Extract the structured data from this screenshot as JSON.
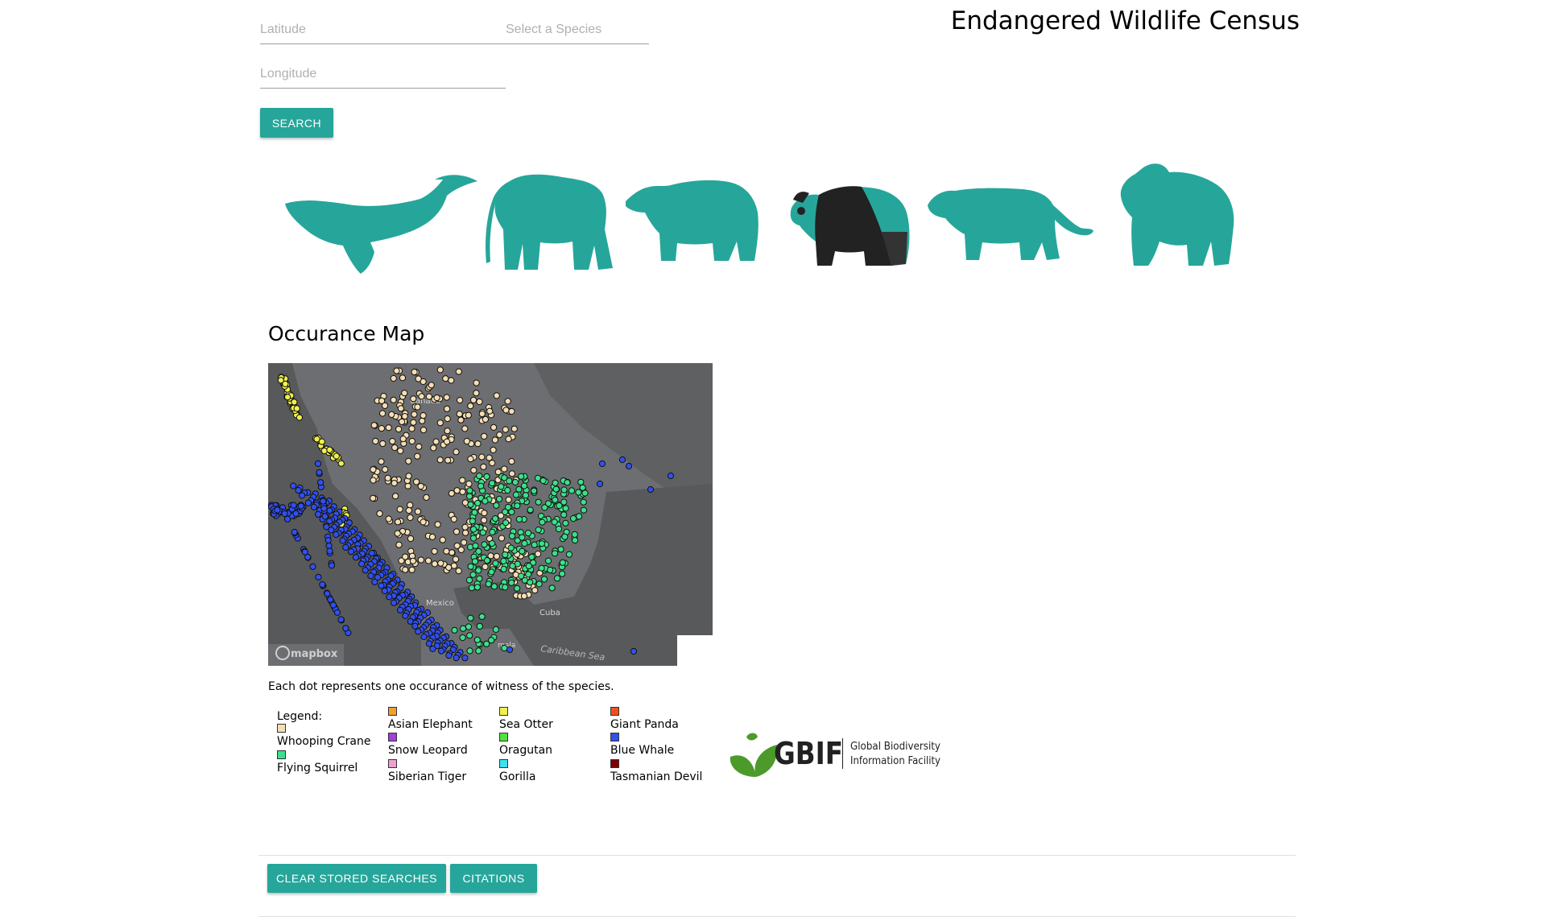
{
  "header": {
    "title": "Endangered Wildlife Census"
  },
  "search": {
    "latitude_placeholder": "Latitude",
    "longitude_placeholder": "Longitude",
    "species_placeholder": "Select a Species",
    "button_label": "SEARCH"
  },
  "animals": [
    "whale-icon",
    "elephant-icon",
    "bear-icon",
    "panda-icon",
    "tiger-icon",
    "gorilla-icon"
  ],
  "map": {
    "title": "Occurance Map",
    "labels": {
      "canada": "Canada",
      "mexico": "Mexico",
      "cuba": "Cuba",
      "guatemala": "mala",
      "caribbean": "Caribbean Sea"
    },
    "attribution": "mapbox",
    "note": "Each dot represents one occurance of witness of the species."
  },
  "legend": {
    "title": "Legend:",
    "items": [
      {
        "label": "Whooping Crane",
        "color": "#f5deb3"
      },
      {
        "label": "Flying Squirrel",
        "color": "#3ce08a"
      },
      {
        "label": "Asian Elephant",
        "color": "#f0a030"
      },
      {
        "label": "Snow Leopard",
        "color": "#a040e0"
      },
      {
        "label": "Siberian Tiger",
        "color": "#f0a0d0"
      },
      {
        "label": "Sea Otter",
        "color": "#f0f050"
      },
      {
        "label": "Oragutan",
        "color": "#50e040"
      },
      {
        "label": "Gorilla",
        "color": "#40e0f0"
      },
      {
        "label": "Giant Panda",
        "color": "#f05020"
      },
      {
        "label": "Blue Whale",
        "color": "#3050f0"
      },
      {
        "label": "Tasmanian Devil",
        "color": "#800000"
      }
    ]
  },
  "gbif": {
    "name": "GBIF",
    "line1": "Global Biodiversity",
    "line2": "Information Facility"
  },
  "footer": {
    "clear_label": "CLEAR STORED SEARCHES",
    "citations_label": "CITATIONS"
  },
  "colors": {
    "accent": "#26a69a",
    "map_land": "#6d6e71",
    "map_water": "#58595b"
  }
}
